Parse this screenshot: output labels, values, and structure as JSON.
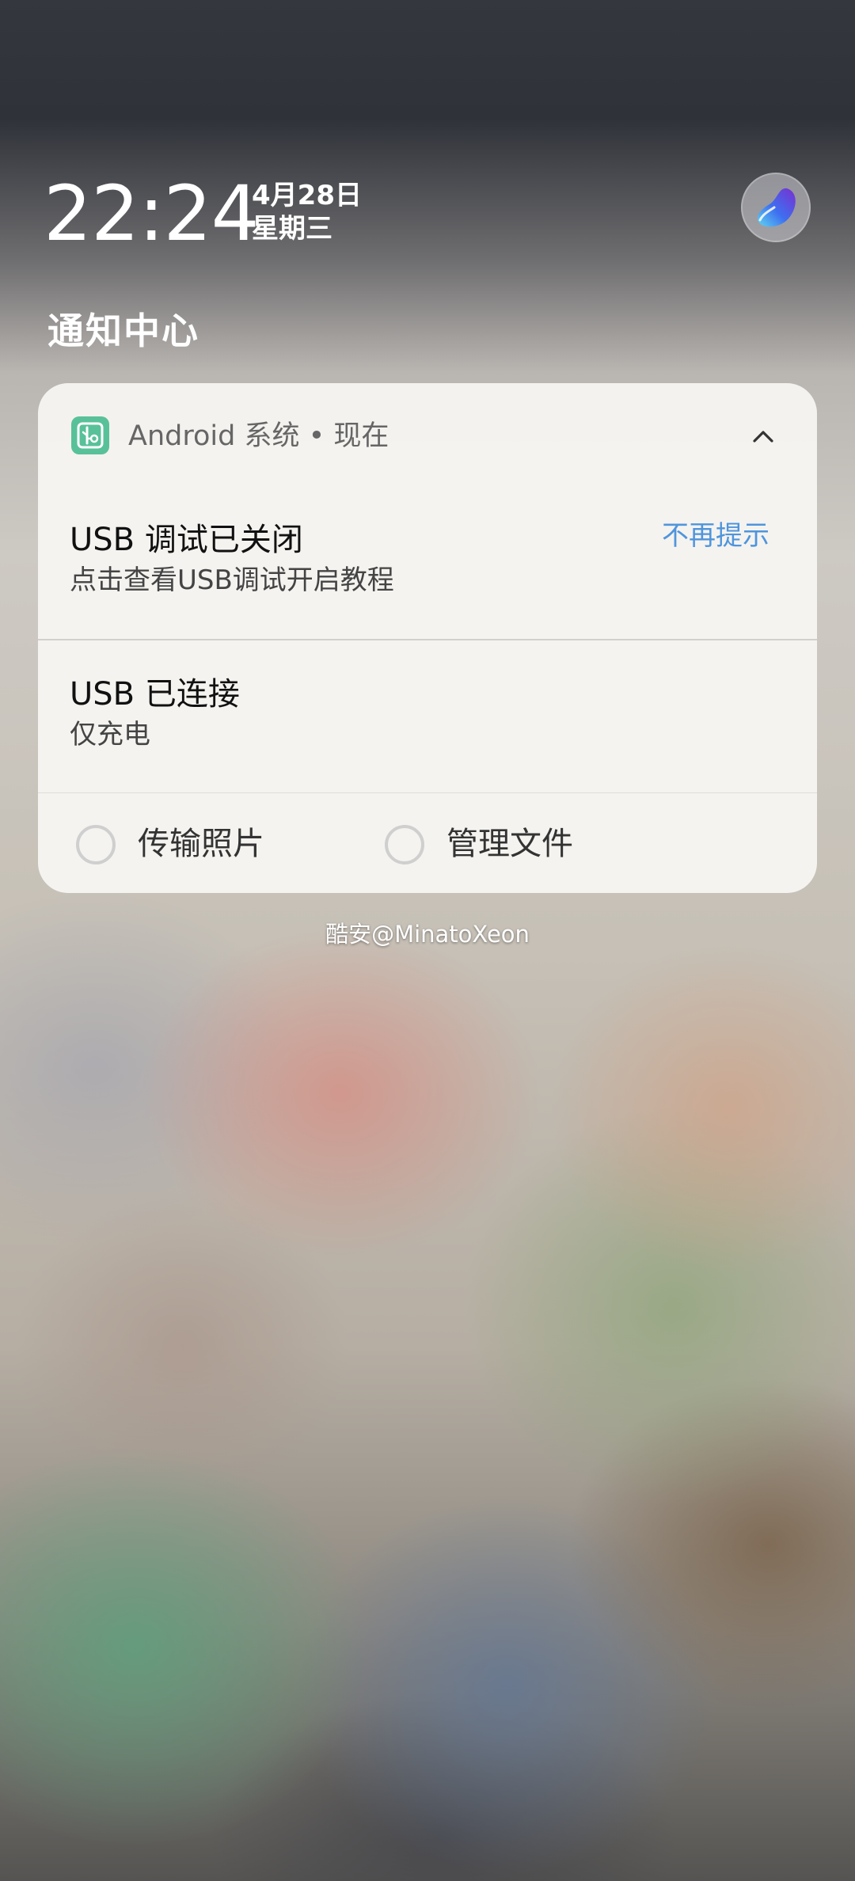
{
  "lockscreen": {
    "time": "22:24",
    "date": "4月28日",
    "weekday": "星期三",
    "notification_center_title": "通知中心"
  },
  "card": {
    "app_name": "Android 系统 • 现在",
    "app_icon": "usb-icon",
    "app_icon_color": "#59c199",
    "collapse_icon": "chevron-up-icon",
    "notifications": [
      {
        "title": "USB 调试已关闭",
        "subtitle": "点击查看USB调试开启教程",
        "action_label": "不再提示",
        "action_color": "#4f95dc"
      },
      {
        "title": "USB 已连接",
        "subtitle": "仅充电"
      }
    ],
    "options": [
      {
        "label": "传输照片",
        "selected": false
      },
      {
        "label": "管理文件",
        "selected": false
      }
    ]
  },
  "watermark": "酷安@MinatoXeon"
}
